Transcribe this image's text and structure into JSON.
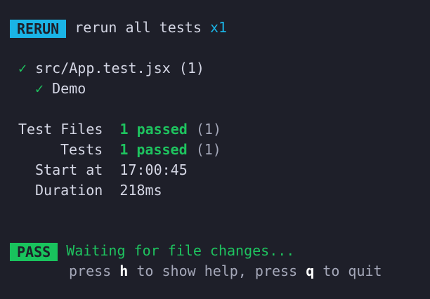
{
  "header": {
    "badge": "RERUN",
    "message": "rerun all tests",
    "count": "x1"
  },
  "file_result": {
    "check": "✓",
    "path": "src/App.test.jsx",
    "count": "(1)",
    "tests": [
      {
        "check": "✓",
        "name": "Demo"
      }
    ]
  },
  "summary": {
    "test_files_label": "Test Files",
    "test_files_value": "1 passed",
    "test_files_count": "(1)",
    "tests_label": "Tests",
    "tests_value": "1 passed",
    "tests_count": "(1)",
    "start_label": "Start at",
    "start_value": "17:00:45",
    "duration_label": "Duration",
    "duration_value": "218ms"
  },
  "footer": {
    "badge": "PASS",
    "status": "Waiting for file changes...",
    "help_prefix": "press",
    "help_key": "h",
    "help_middle": "to show help, press",
    "quit_key": "q",
    "help_suffix": "to quit"
  },
  "colors": {
    "background": "#1e1f29",
    "pass_green": "#19c35d",
    "rerun_cyan": "#1ab4e6",
    "text": "#d4d6e4"
  }
}
